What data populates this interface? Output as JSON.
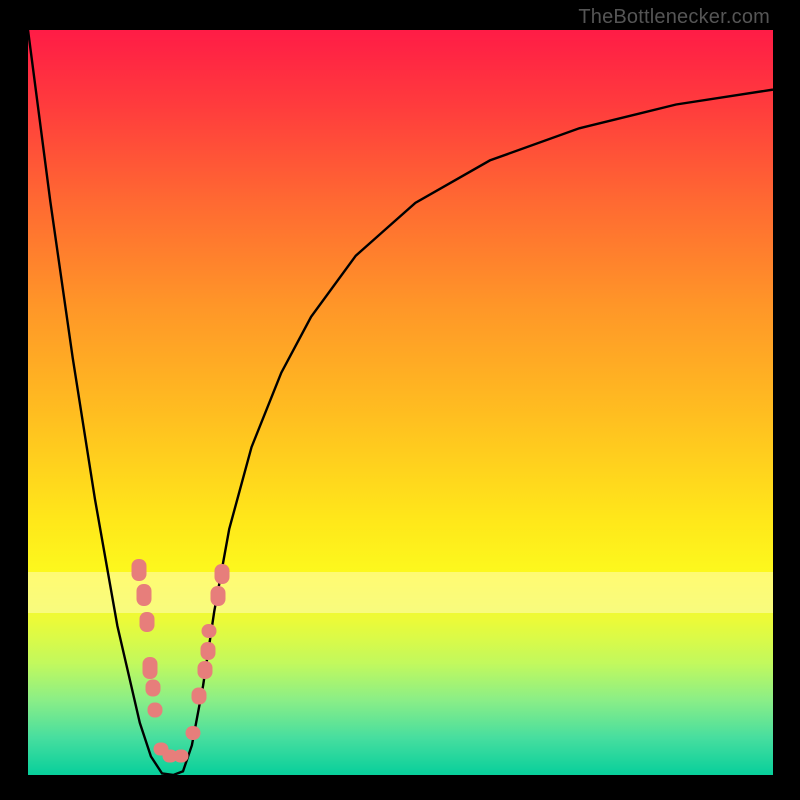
{
  "attribution": "TheBottlenecker.com",
  "colors": {
    "dot_fill": "#e77e7b",
    "curve_stroke": "#000000"
  },
  "chart_data": {
    "type": "line",
    "title": "",
    "xlabel": "",
    "ylabel": "",
    "xlim": [
      0,
      1
    ],
    "ylim": [
      0,
      1
    ],
    "series": [
      {
        "name": "bottleneck-curve",
        "x": [
          0.0,
          0.03,
          0.06,
          0.09,
          0.12,
          0.15,
          0.165,
          0.18,
          0.195,
          0.208,
          0.22,
          0.235,
          0.25,
          0.27,
          0.3,
          0.34,
          0.38,
          0.44,
          0.52,
          0.62,
          0.74,
          0.87,
          1.0
        ],
        "y": [
          1.0,
          0.77,
          0.56,
          0.37,
          0.2,
          0.07,
          0.025,
          0.002,
          0.0,
          0.005,
          0.04,
          0.12,
          0.22,
          0.33,
          0.44,
          0.54,
          0.615,
          0.697,
          0.768,
          0.825,
          0.868,
          0.9,
          0.92
        ]
      }
    ],
    "annotations": {
      "highlight_band_y": [
        0.218,
        0.272
      ],
      "dots": [
        {
          "x_frac": 0.149,
          "y_frac": 0.725,
          "len": 22
        },
        {
          "x_frac": 0.156,
          "y_frac": 0.758,
          "len": 22
        },
        {
          "x_frac": 0.16,
          "y_frac": 0.795,
          "len": 20
        },
        {
          "x_frac": 0.164,
          "y_frac": 0.856,
          "len": 22
        },
        {
          "x_frac": 0.168,
          "y_frac": 0.883,
          "len": 17
        },
        {
          "x_frac": 0.171,
          "y_frac": 0.913,
          "len": 15
        },
        {
          "x_frac": 0.178,
          "y_frac": 0.965,
          "len": 13
        },
        {
          "x_frac": 0.191,
          "y_frac": 0.975,
          "len": 13
        },
        {
          "x_frac": 0.205,
          "y_frac": 0.975,
          "len": 13
        },
        {
          "x_frac": 0.221,
          "y_frac": 0.944,
          "len": 14
        },
        {
          "x_frac": 0.23,
          "y_frac": 0.894,
          "len": 17
        },
        {
          "x_frac": 0.237,
          "y_frac": 0.859,
          "len": 18
        },
        {
          "x_frac": 0.242,
          "y_frac": 0.833,
          "len": 18
        },
        {
          "x_frac": 0.243,
          "y_frac": 0.807,
          "len": 14
        },
        {
          "x_frac": 0.255,
          "y_frac": 0.76,
          "len": 20
        },
        {
          "x_frac": 0.261,
          "y_frac": 0.73,
          "len": 20
        }
      ]
    }
  }
}
